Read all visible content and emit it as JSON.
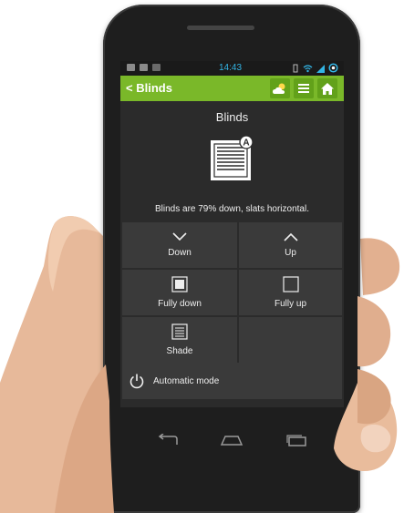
{
  "statusbar": {
    "time": "14:43",
    "left_icons": [
      "image-icon",
      "cat-icon",
      "deer-icon"
    ],
    "right_icons": [
      "vibrate-icon",
      "wifi-icon",
      "signal-icon",
      "battery-icon"
    ]
  },
  "appbar": {
    "back_label": "< Blinds",
    "accent_color": "#7ab829",
    "buttons": [
      "weather-icon",
      "menu-icon",
      "home-icon"
    ]
  },
  "page": {
    "title": "Blinds",
    "badge": "A",
    "status": "Blinds are 79% down, slats horizontal."
  },
  "controls": {
    "down": "Down",
    "up": "Up",
    "fully_down": "Fully down",
    "fully_up": "Fully up",
    "shade": "Shade",
    "auto_mode": "Automatic mode"
  }
}
